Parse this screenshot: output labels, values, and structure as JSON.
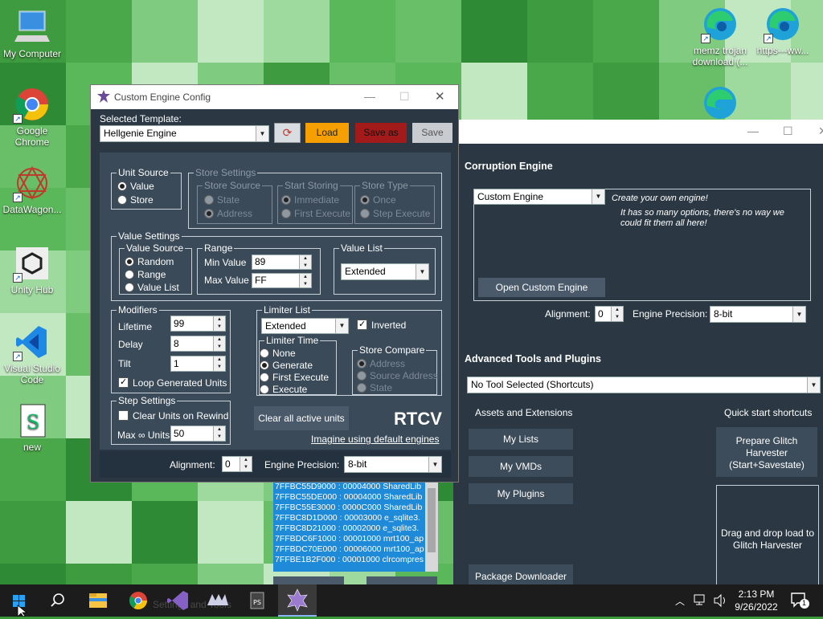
{
  "desktop": {
    "icons": [
      {
        "name": "my-computer",
        "label": "My Computer"
      },
      {
        "name": "google-chrome",
        "label": "Google Chrome"
      },
      {
        "name": "datawagon",
        "label": "DataWagon..."
      },
      {
        "name": "unity-hub",
        "label": "Unity Hub"
      },
      {
        "name": "visual-studio-code",
        "label": "Visual Studio Code"
      },
      {
        "name": "new",
        "label": "new"
      },
      {
        "name": "memz",
        "label": "memz trojan download (..."
      },
      {
        "name": "https",
        "label": "https---ww..."
      }
    ]
  },
  "rtcv": {
    "corruption_engine_header": "Corruption Engine",
    "engine_select": "Custom Engine",
    "engine_desc_1": "Create your own engine!",
    "engine_desc_2": "It has so many options, there's no way we could fit them all here!",
    "open_custom_engine": "Open Custom Engine",
    "alignment_label": "Alignment:",
    "alignment_value": "0",
    "precision_label": "Engine Precision:",
    "precision_value": "8-bit",
    "advanced_header": "Advanced Tools and Plugins",
    "tool_select": "No Tool Selected (Shortcuts)",
    "assets_header": "Assets and Extensions",
    "quick_header": "Quick start shortcuts",
    "my_lists": "My Lists",
    "my_vmds": "My VMDs",
    "my_plugins": "My Plugins",
    "package_downloader": "Package Downloader",
    "prepare_glitch": "Prepare Glitch Harvester (Start+Savestate)",
    "drag_drop": "Drag and drop load to Glitch Harvester"
  },
  "memlist": {
    "rows": [
      "7FFBC55D9000 : 00004000 SharedLib",
      "7FFBC55DE000 : 00004000 SharedLib",
      "7FFBC55E3000 : 0000C000 SharedLib",
      "7FFBC8D1D000 : 00003000 e_sqlite3.",
      "7FFBC8D21000 : 00002000 e_sqlite3.",
      "7FFBDC6F1000 : 00001000 mrt100_ap",
      "7FFBDC70E000 : 00006000 mrt100_ap",
      "7FFBE1B2F000 : 00001000 clrcompres"
    ]
  },
  "cfg": {
    "title": "Custom Engine Config",
    "selected_template_label": "Selected Template:",
    "template_value": "Hellgenie Engine",
    "load": "Load",
    "save_as": "Save as",
    "save": "Save",
    "unit_source": "Unit Source",
    "us_value": "Value",
    "us_store": "Store",
    "store_settings": "Store Settings",
    "store_source": "Store Source",
    "ss_state": "State",
    "ss_address": "Address",
    "start_storing": "Start Storing",
    "st_immediate": "Immediate",
    "st_first_execute": "First Execute",
    "store_type": "Store Type",
    "sty_once": "Once",
    "sty_step": "Step Execute",
    "value_settings": "Value Settings",
    "value_source": "Value Source",
    "vs_random": "Random",
    "vs_range": "Range",
    "vs_value_list": "Value List",
    "range": "Range",
    "min_value_label": "Min Value",
    "min_value": "89",
    "max_value_label": "Max Value",
    "max_value": "FF",
    "value_list": "Value List",
    "value_list_select": "Extended",
    "modifiers": "Modifiers",
    "lifetime_label": "Lifetime",
    "lifetime": "99",
    "delay_label": "Delay",
    "delay": "8",
    "tilt_label": "Tilt",
    "tilt": "1",
    "loop_generated": "Loop Generated Units",
    "limiter_list": "Limiter List",
    "limiter_select": "Extended",
    "inverted": "Inverted",
    "limiter_time": "Limiter Time",
    "lt_none": "None",
    "lt_generate": "Generate",
    "lt_first_execute": "First Execute",
    "lt_execute": "Execute",
    "store_compare": "Store Compare",
    "sc_address": "Address",
    "sc_source_address": "Source Address",
    "sc_state": "State",
    "step_settings": "Step Settings",
    "clear_on_rewind": "Clear Units on Rewind",
    "max_units_label": "Max ∞ Units",
    "max_units": "50",
    "clear_all": "Clear all active units",
    "rtcv_logo": "RTCV",
    "imagine": "Imagine using default engines",
    "alignment_label": "Alignment:",
    "alignment_value": "0",
    "precision_label": "Engine Precision:",
    "precision_value": "8-bit"
  },
  "taskbar": {
    "time": "2:13 PM",
    "date": "9/26/2022",
    "notif_count": "1",
    "ghost_label": "Settings and Tools"
  },
  "colors": {
    "load": "#f5a000",
    "save_as": "#a31a1a",
    "panel_bg": "#2b3844",
    "list_bg": "#1f8ad8"
  }
}
